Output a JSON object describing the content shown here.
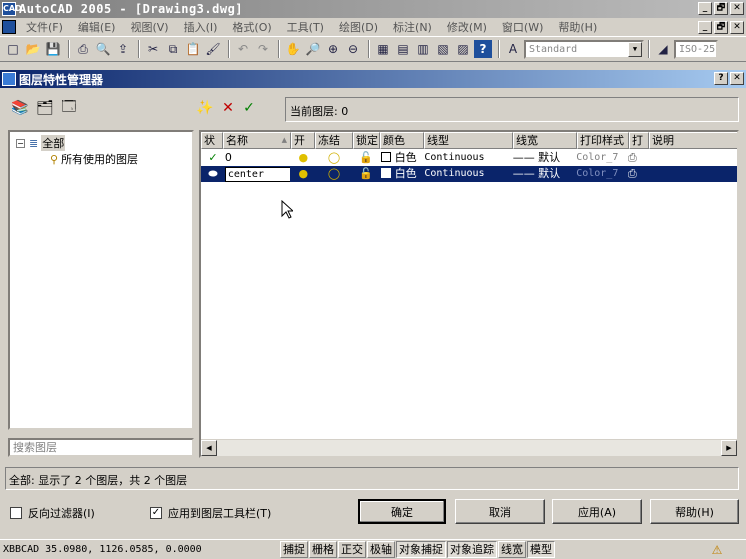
{
  "window": {
    "title": "AutoCAD 2005 - [Drawing3.dwg]",
    "app_icon_text": "CAD",
    "controls": [
      "_",
      "🗗",
      "✕"
    ]
  },
  "menubar": {
    "items": [
      "文件(F)",
      "编辑(E)",
      "视图(V)",
      "插入(I)",
      "格式(O)",
      "工具(T)",
      "绘图(D)",
      "标注(N)",
      "修改(M)",
      "窗口(W)",
      "帮助(H)"
    ],
    "doc_controls": [
      "_",
      "🗗",
      "✕"
    ]
  },
  "toolbar": {
    "text_style": "Standard",
    "dim_style": "ISO-25"
  },
  "dialog": {
    "title": "图层特性管理器",
    "help": "?",
    "close": "✕",
    "current_layer_label": "当前图层: 0",
    "tree": {
      "root": "全部",
      "child": "所有使用的图层",
      "expander": "−"
    },
    "search_placeholder": "搜索图层",
    "columns": [
      "状",
      "名称",
      "开",
      "冻结",
      "锁定",
      "颜色",
      "线型",
      "线宽",
      "打印样式",
      "打",
      "说明"
    ],
    "sort_indicator": "▲",
    "layers": [
      {
        "status": "✓",
        "name": "0",
        "color": "白色",
        "linetype": "Continuous",
        "lineweight": "—— 默认",
        "plot_style": "Color_7",
        "selected": false
      },
      {
        "status": "⬬",
        "name": "center",
        "color": "白色",
        "linetype": "Continuous",
        "lineweight": "—— 默认",
        "plot_style": "Color_7",
        "selected": true
      }
    ],
    "status_text": "全部: 显示了 2 个图层，共 2 个图层",
    "invert_filter_label": "反向过滤器(I)",
    "invert_filter_checked": false,
    "apply_toolbar_label": "应用到图层工具栏(T)",
    "apply_toolbar_checked": true,
    "buttons": {
      "ok": "确定",
      "cancel": "取消",
      "apply": "应用(A)",
      "help": "帮助(H)"
    }
  },
  "statusbar": {
    "command": "XBBCAD",
    "coords": "35.0980,   1126.0585, 0.0000",
    "toggles": [
      "捕捉",
      "栅格",
      "正交",
      "极轴",
      "对象捕捉",
      "对象追踪",
      "线宽",
      "模型"
    ],
    "active_toggles": [
      "对象捕捉",
      "对象追踪",
      "模型"
    ]
  },
  "colors": {
    "dialog_title": "#0a246a",
    "selection": "#0a246a",
    "window_title": "#808080"
  }
}
